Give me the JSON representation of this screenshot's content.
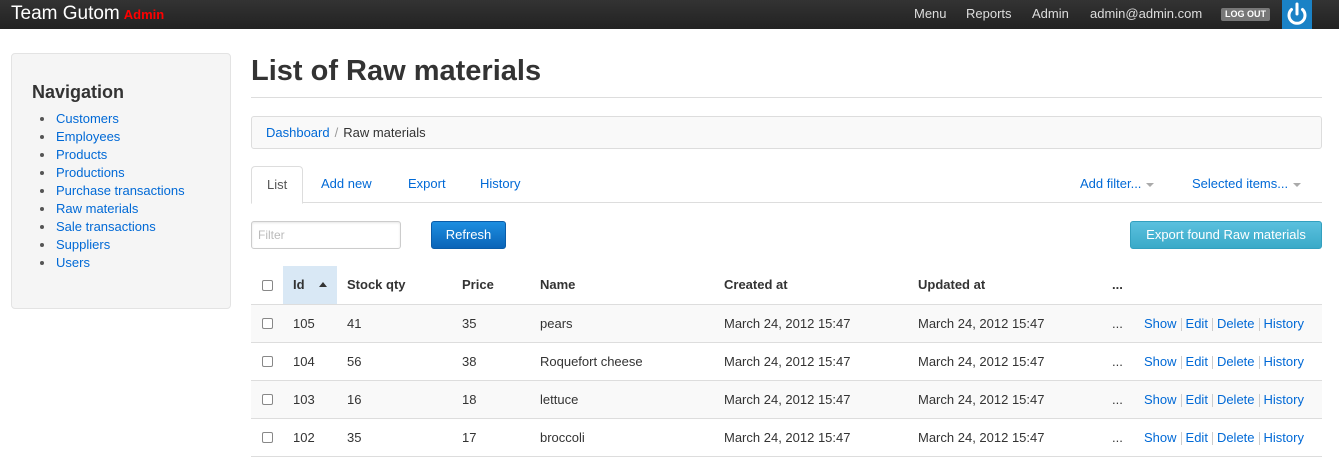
{
  "topbar": {
    "brand": "Team Gutom",
    "brand_badge": "Admin",
    "nav": [
      "Menu",
      "Reports",
      "Admin",
      "admin@admin.com"
    ],
    "logout_label": "LOG OUT"
  },
  "sidebar": {
    "title": "Navigation",
    "items": [
      {
        "label": "Customers"
      },
      {
        "label": "Employees"
      },
      {
        "label": "Products"
      },
      {
        "label": "Productions"
      },
      {
        "label": "Purchase transactions"
      },
      {
        "label": "Raw materials"
      },
      {
        "label": "Sale transactions"
      },
      {
        "label": "Suppliers"
      },
      {
        "label": "Users"
      }
    ]
  },
  "main": {
    "title": "List of Raw materials",
    "breadcrumb": {
      "root": "Dashboard",
      "separator": "/",
      "current": "Raw materials"
    },
    "tabs": [
      {
        "label": "List"
      },
      {
        "label": "Add new"
      },
      {
        "label": "Export"
      },
      {
        "label": "History"
      }
    ],
    "add_filter_label": "Add filter...",
    "selected_items_label": "Selected items...",
    "filter_placeholder": "Filter",
    "refresh_label": "Refresh",
    "export_label": "Export found Raw materials"
  },
  "table": {
    "columns": {
      "id": "Id",
      "stock": "Stock qty",
      "price": "Price",
      "name": "Name",
      "created": "Created at",
      "updated": "Updated at",
      "more": "..."
    },
    "rows": [
      {
        "id": "105",
        "stock": "41",
        "price": "35",
        "name": "pears",
        "created": "March 24, 2012 15:47",
        "updated": "March 24, 2012 15:47",
        "more": "..."
      },
      {
        "id": "104",
        "stock": "56",
        "price": "38",
        "name": "Roquefort cheese",
        "created": "March 24, 2012 15:47",
        "updated": "March 24, 2012 15:47",
        "more": "..."
      },
      {
        "id": "103",
        "stock": "16",
        "price": "18",
        "name": "lettuce",
        "created": "March 24, 2012 15:47",
        "updated": "March 24, 2012 15:47",
        "more": "..."
      },
      {
        "id": "102",
        "stock": "35",
        "price": "17",
        "name": "broccoli",
        "created": "March 24, 2012 15:47",
        "updated": "March 24, 2012 15:47",
        "more": "..."
      }
    ],
    "actions": {
      "show": "Show",
      "edit": "Edit",
      "delete": "Delete",
      "history": "History"
    }
  },
  "colors": {
    "link": "#0069d6",
    "brand_badge": "#ff0000",
    "primary_button": "#0a64b8",
    "info_button": "#5bc0de",
    "topbar": "#222222"
  },
  "icons": {
    "power": "power-icon",
    "sort": "sort-ascending-icon"
  }
}
